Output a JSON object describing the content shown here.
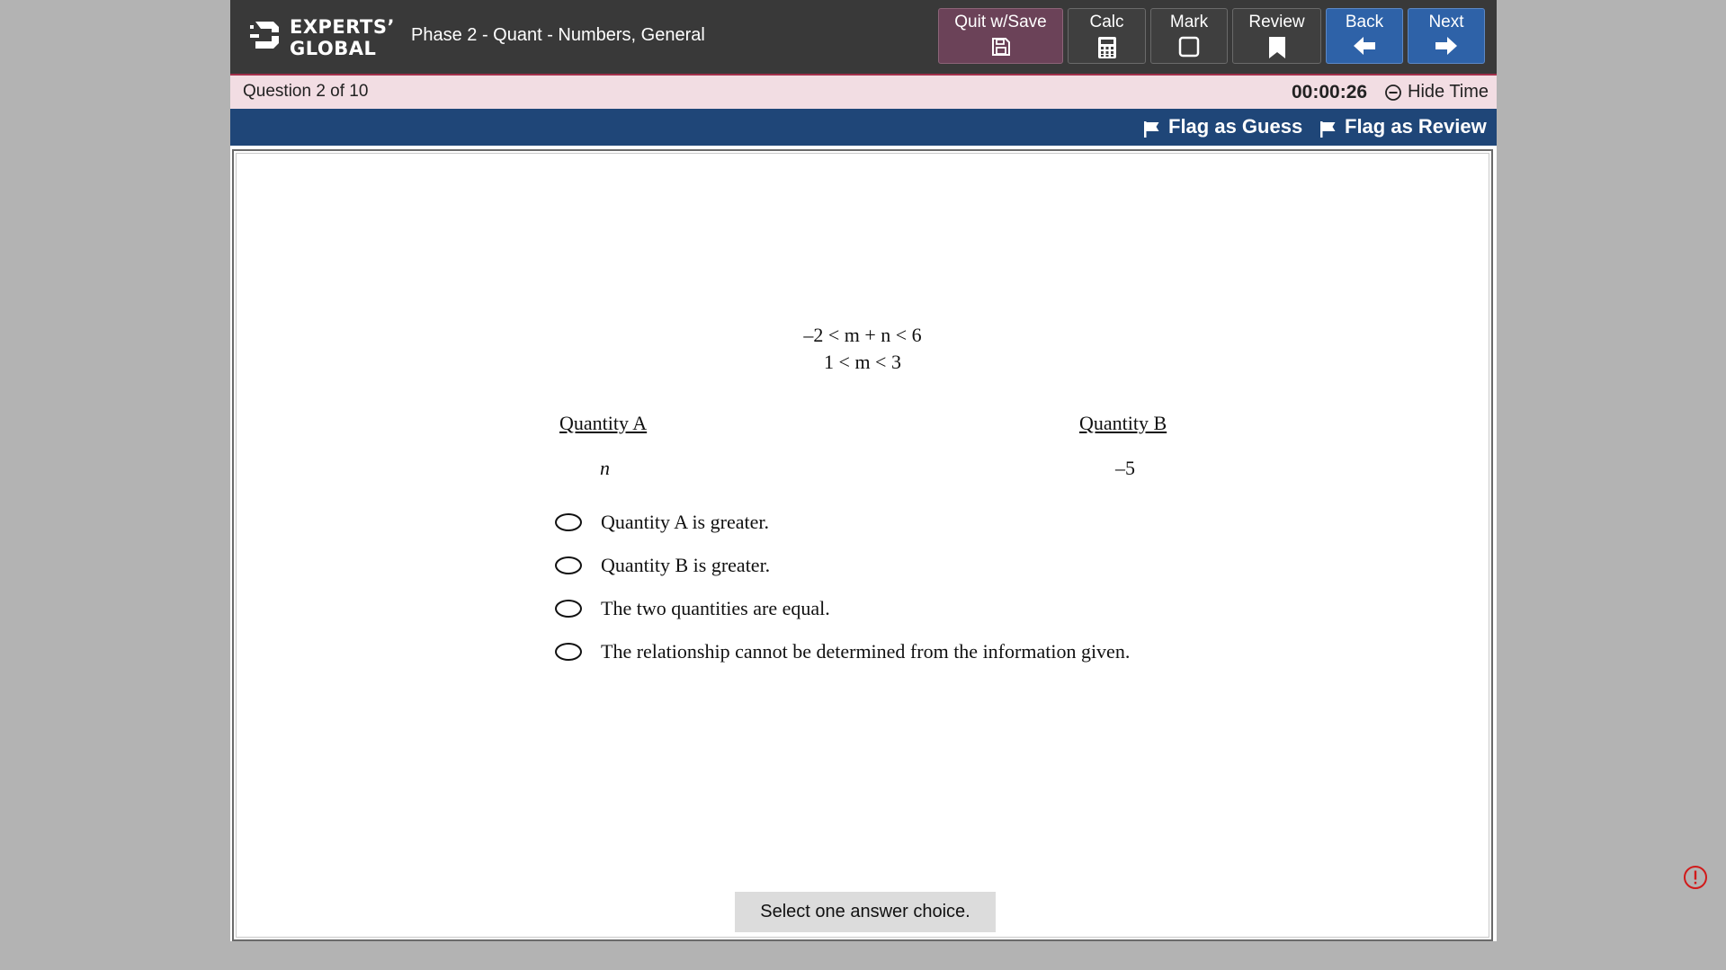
{
  "header": {
    "logo_line1": "EXPERTS’",
    "logo_line2": "GLOBAL",
    "title": "Phase 2 - Quant - Numbers, General",
    "buttons": {
      "quit": {
        "label": "Quit w/Save",
        "icon": "save-icon"
      },
      "calc": {
        "label": "Calc",
        "icon": "calculator-icon"
      },
      "mark": {
        "label": "Mark",
        "icon": "checkbox-icon"
      },
      "review": {
        "label": "Review",
        "icon": "bookmark-icon"
      },
      "back": {
        "label": "Back",
        "icon": "arrow-left-icon"
      },
      "next": {
        "label": "Next",
        "icon": "arrow-right-icon"
      }
    }
  },
  "status": {
    "question_counter": "Question 2 of 10",
    "timer": "00:00:26",
    "hide_time": "Hide Time"
  },
  "flags": {
    "guess": "Flag as Guess",
    "review": "Flag as Review"
  },
  "question": {
    "condition1": "–2 < m + n < 6",
    "condition2": "1 < m < 3",
    "quantity_a_label": "Quantity A",
    "quantity_b_label": "Quantity B",
    "quantity_a_value": "n",
    "quantity_b_value": "–5",
    "choices": [
      "Quantity A is greater.",
      "Quantity B is greater.",
      "The two quantities are equal.",
      "The relationship cannot be determined from the information given."
    ],
    "hint": "Select one answer choice."
  },
  "colors": {
    "header_bg": "#393939",
    "quit_bg": "#6b4258",
    "nav_blue": "#2e62a8",
    "question_bar_bg": "#f2dde3",
    "flag_bar_bg": "#1f4678",
    "alert_red": "#d11a1a"
  }
}
